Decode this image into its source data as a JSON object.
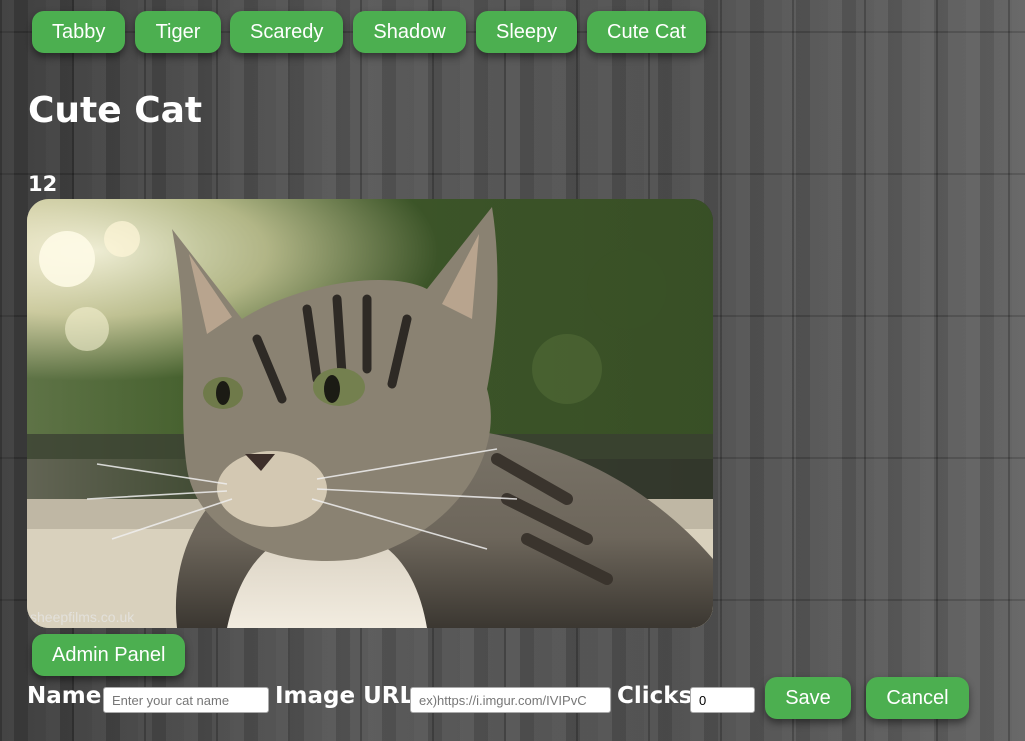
{
  "nav": {
    "cats": [
      "Tabby",
      "Tiger",
      "Scaredy",
      "Shadow",
      "Sleepy",
      "Cute Cat"
    ]
  },
  "cat": {
    "name": "Cute Cat",
    "clicks": "12",
    "image_watermark": "sheepfilms.co.uk"
  },
  "admin": {
    "button_label": "Admin Panel",
    "name_label": "Name",
    "name_placeholder": "Enter your cat name",
    "url_label": "Image URL",
    "url_placeholder": "ex)https://i.imgur.com/IVIPvC",
    "clicks_label": "Clicks",
    "clicks_value": "0",
    "save_label": "Save",
    "cancel_label": "Cancel"
  },
  "colors": {
    "button": "#4caf50",
    "text": "#ffffff"
  }
}
